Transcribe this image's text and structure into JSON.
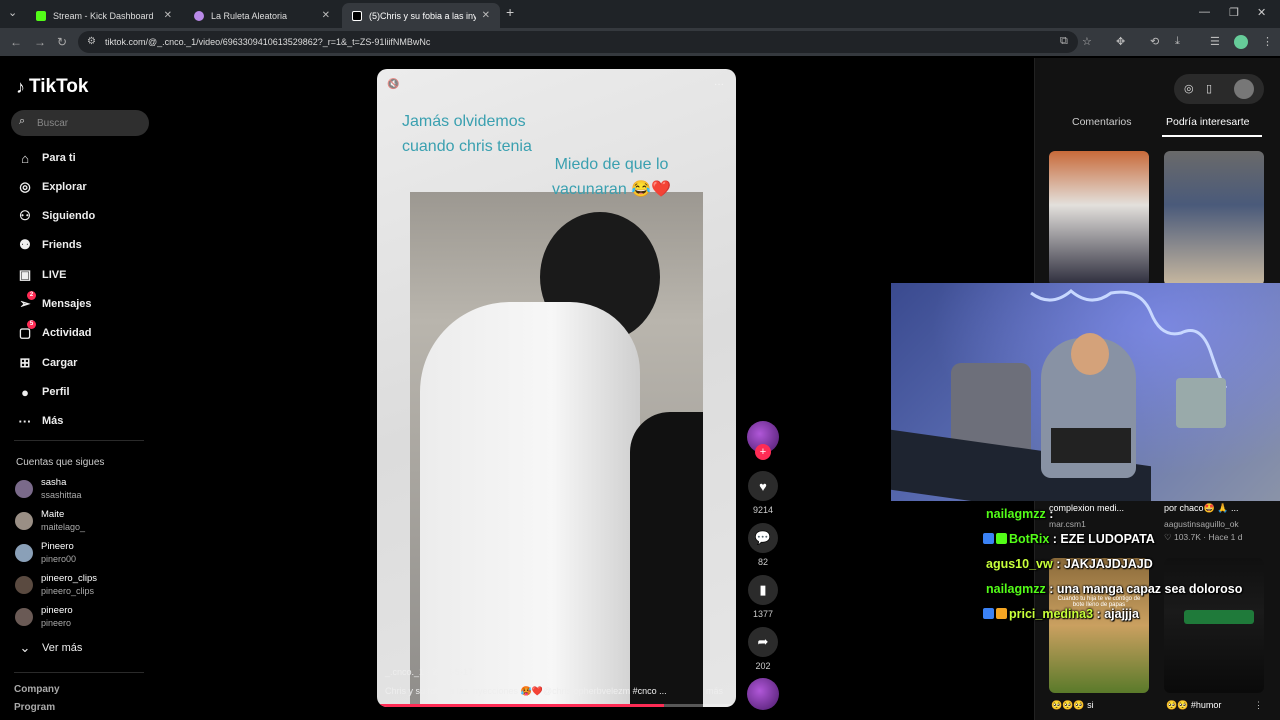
{
  "browser": {
    "tabs": [
      {
        "title": "Stream - Kick Dashboard",
        "favicon_color": "#53fc18"
      },
      {
        "title": "La Ruleta Aleatoria",
        "favicon_color": "#b98ae8"
      },
      {
        "title": "(5)Chris y su fobia a las inyeccio",
        "favicon_color": "#ffffff"
      }
    ],
    "url": "tiktok.com/@_.cnco._1/video/6963309410613529862?_r=1&_t=ZS-91liifNMBwNc"
  },
  "sidebar": {
    "logo": "TikTok",
    "search_placeholder": "Buscar",
    "nav": [
      {
        "label": "Para ti",
        "icon": "home-icon",
        "glyph": "⌂"
      },
      {
        "label": "Explorar",
        "icon": "compass-icon",
        "glyph": "◎"
      },
      {
        "label": "Siguiendo",
        "icon": "following-icon",
        "glyph": "⚇"
      },
      {
        "label": "Friends",
        "icon": "friends-icon",
        "glyph": "⚉"
      },
      {
        "label": "LIVE",
        "icon": "live-icon",
        "glyph": "▣"
      },
      {
        "label": "Mensajes",
        "icon": "messages-icon",
        "glyph": "➢",
        "badge": "2"
      },
      {
        "label": "Actividad",
        "icon": "activity-icon",
        "glyph": "▢",
        "badge": "5"
      },
      {
        "label": "Cargar",
        "icon": "upload-icon",
        "glyph": "⊞"
      },
      {
        "label": "Perfil",
        "icon": "profile-icon",
        "glyph": "●"
      },
      {
        "label": "Más",
        "icon": "more-icon",
        "glyph": "···"
      }
    ],
    "following_heading": "Cuentas que sigues",
    "accounts": [
      {
        "name": "sasha",
        "user": "ssashittaa",
        "color": "#7a6a8a"
      },
      {
        "name": "Maite",
        "user": "maitelago_",
        "color": "#9a8f85"
      },
      {
        "name": "Pineero",
        "user": "pinero00",
        "color": "#8aa0b8"
      },
      {
        "name": "pineero_clips",
        "user": "pineero_clips",
        "color": "#5a4a40"
      },
      {
        "name": "pineero",
        "user": "pineero",
        "color": "#6a5a55"
      }
    ],
    "see_more": "Ver más",
    "footer": [
      "Company",
      "Program"
    ]
  },
  "video": {
    "caption_top": [
      "Jamás olvidemos",
      "cuando chris tenia"
    ],
    "caption_right": [
      "Miedo de que lo",
      "vacunaran 😂❤️"
    ],
    "author_date": "_.cnco._1 · 2021-5-17",
    "description": "Chris y su fobia a las inyecciones 🥵❤️@christopherbvelezm  #cnco  ...",
    "more": "más",
    "progress": 0.8
  },
  "actions": {
    "likes": "9214",
    "comments": "82",
    "saves": "1377",
    "shares": "202"
  },
  "right_panel": {
    "tabs": [
      "Comentarios",
      "Podría interesarte"
    ],
    "items": [
      {
        "caption": "complexion medi...",
        "sub": "mar.csm1"
      },
      {
        "caption": "por chaco🤩 🙏 ...",
        "sub": "aagustinsaguillo_ok",
        "stats": "♡ 103.7K · Hace 1 d"
      },
      {
        "caption": "🥺🥺🥺 si",
        "sub": ""
      },
      {
        "caption": "🥺🥺 #humor",
        "sub": ""
      }
    ],
    "thumb_text": "Cuando tu hija te ve contigo de bote lleno de papas"
  },
  "chat": [
    {
      "user": "nailagmzz",
      "msg": "",
      "user_color": "#53fc18",
      "badges": []
    },
    {
      "user": "BotRix",
      "msg": "EZE LUDOPATA",
      "user_color": "#53fc18",
      "badges": [
        "#3b82f6",
        "#53fc18"
      ]
    },
    {
      "user": "agus10_vw",
      "msg": "JAKJAJDJAJD",
      "user_color": "#c8ff3a",
      "badges": []
    },
    {
      "user": "nailagmzz",
      "msg": "una manga capaz sea doloroso",
      "user_color": "#53fc18",
      "badges": []
    },
    {
      "user": "prici_medina3",
      "msg": "ajajjja",
      "user_color": "#c8ff3a",
      "badges": [
        "#3b82f6",
        "#f5a623"
      ]
    }
  ]
}
